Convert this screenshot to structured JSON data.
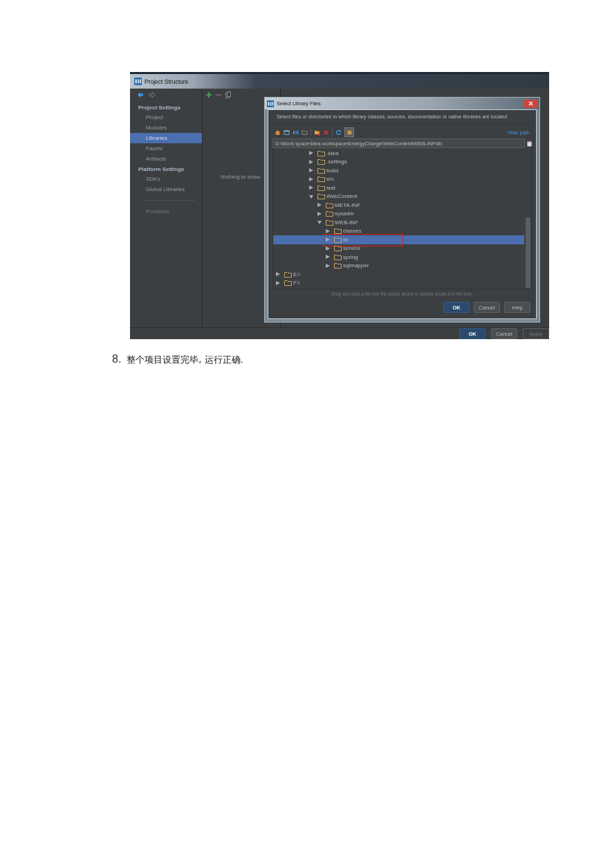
{
  "window": {
    "title": "Project Structure"
  },
  "sidebar": {
    "items": [
      {
        "kind": "header",
        "label": "Project Settings"
      },
      {
        "kind": "item",
        "label": "Project",
        "selected": false
      },
      {
        "kind": "item",
        "label": "Modules",
        "selected": false
      },
      {
        "kind": "item",
        "label": "Libraries",
        "selected": true
      },
      {
        "kind": "item",
        "label": "Facets",
        "selected": false
      },
      {
        "kind": "item",
        "label": "Artifacts",
        "selected": false
      },
      {
        "kind": "header",
        "label": "Platform Settings"
      },
      {
        "kind": "item",
        "label": "SDKs",
        "selected": false
      },
      {
        "kind": "item",
        "label": "Global Libraries",
        "selected": false
      }
    ],
    "footer_item": "Problems"
  },
  "library_list": {
    "empty_text": "Nothing to show"
  },
  "dialog": {
    "title": "Select Library Files",
    "description": "Select files or directories in which library classes, sources, documentation or native libraries are located",
    "hide_path_link": "Hide path",
    "path": "D:\\Work space\\Idea workspace\\EnergyCharge\\WebContent\\WEB-INF\\lib",
    "tree": {
      "branch": [
        {
          "name": ".idea",
          "expanded": false,
          "selected": false
        },
        {
          "name": ".settings",
          "expanded": false,
          "selected": false
        },
        {
          "name": "build",
          "expanded": false,
          "selected": false
        },
        {
          "name": "src",
          "expanded": false,
          "selected": false
        },
        {
          "name": "test",
          "expanded": false,
          "selected": false
        },
        {
          "name": "WebContent",
          "expanded": true,
          "selected": false,
          "children": [
            {
              "name": "META-INF",
              "expanded": false,
              "selected": false
            },
            {
              "name": "sysadm",
              "expanded": false,
              "selected": false
            },
            {
              "name": "WEB-INF",
              "expanded": true,
              "selected": false,
              "children": [
                {
                  "name": "classes",
                  "expanded": false,
                  "selected": false
                },
                {
                  "name": "lib",
                  "expanded": false,
                  "selected": true,
                  "annotated": true
                },
                {
                  "name": "service",
                  "expanded": false,
                  "selected": false
                },
                {
                  "name": "spring",
                  "expanded": false,
                  "selected": false
                },
                {
                  "name": "sqlmapper",
                  "expanded": false,
                  "selected": false
                }
              ]
            }
          ]
        }
      ],
      "roots": [
        {
          "name": "E:\\",
          "expanded": false,
          "selected": false
        },
        {
          "name": "F:\\",
          "expanded": false,
          "selected": false
        }
      ]
    },
    "hint": "Drag and drop a file into the space above to quickly locate it in the tree.",
    "buttons": [
      {
        "label": "OK",
        "kind": "primary"
      },
      {
        "label": "Cancel",
        "kind": "normal"
      },
      {
        "label": "Help",
        "kind": "normal"
      }
    ]
  },
  "bottom_buttons": [
    {
      "label": "OK",
      "kind": "primary"
    },
    {
      "label": "Cancel",
      "kind": "normal"
    },
    {
      "label": "Apply",
      "kind": "disabled"
    }
  ],
  "caption": {
    "number": "8.",
    "text": "整个项目设置完毕, 运行正确."
  }
}
